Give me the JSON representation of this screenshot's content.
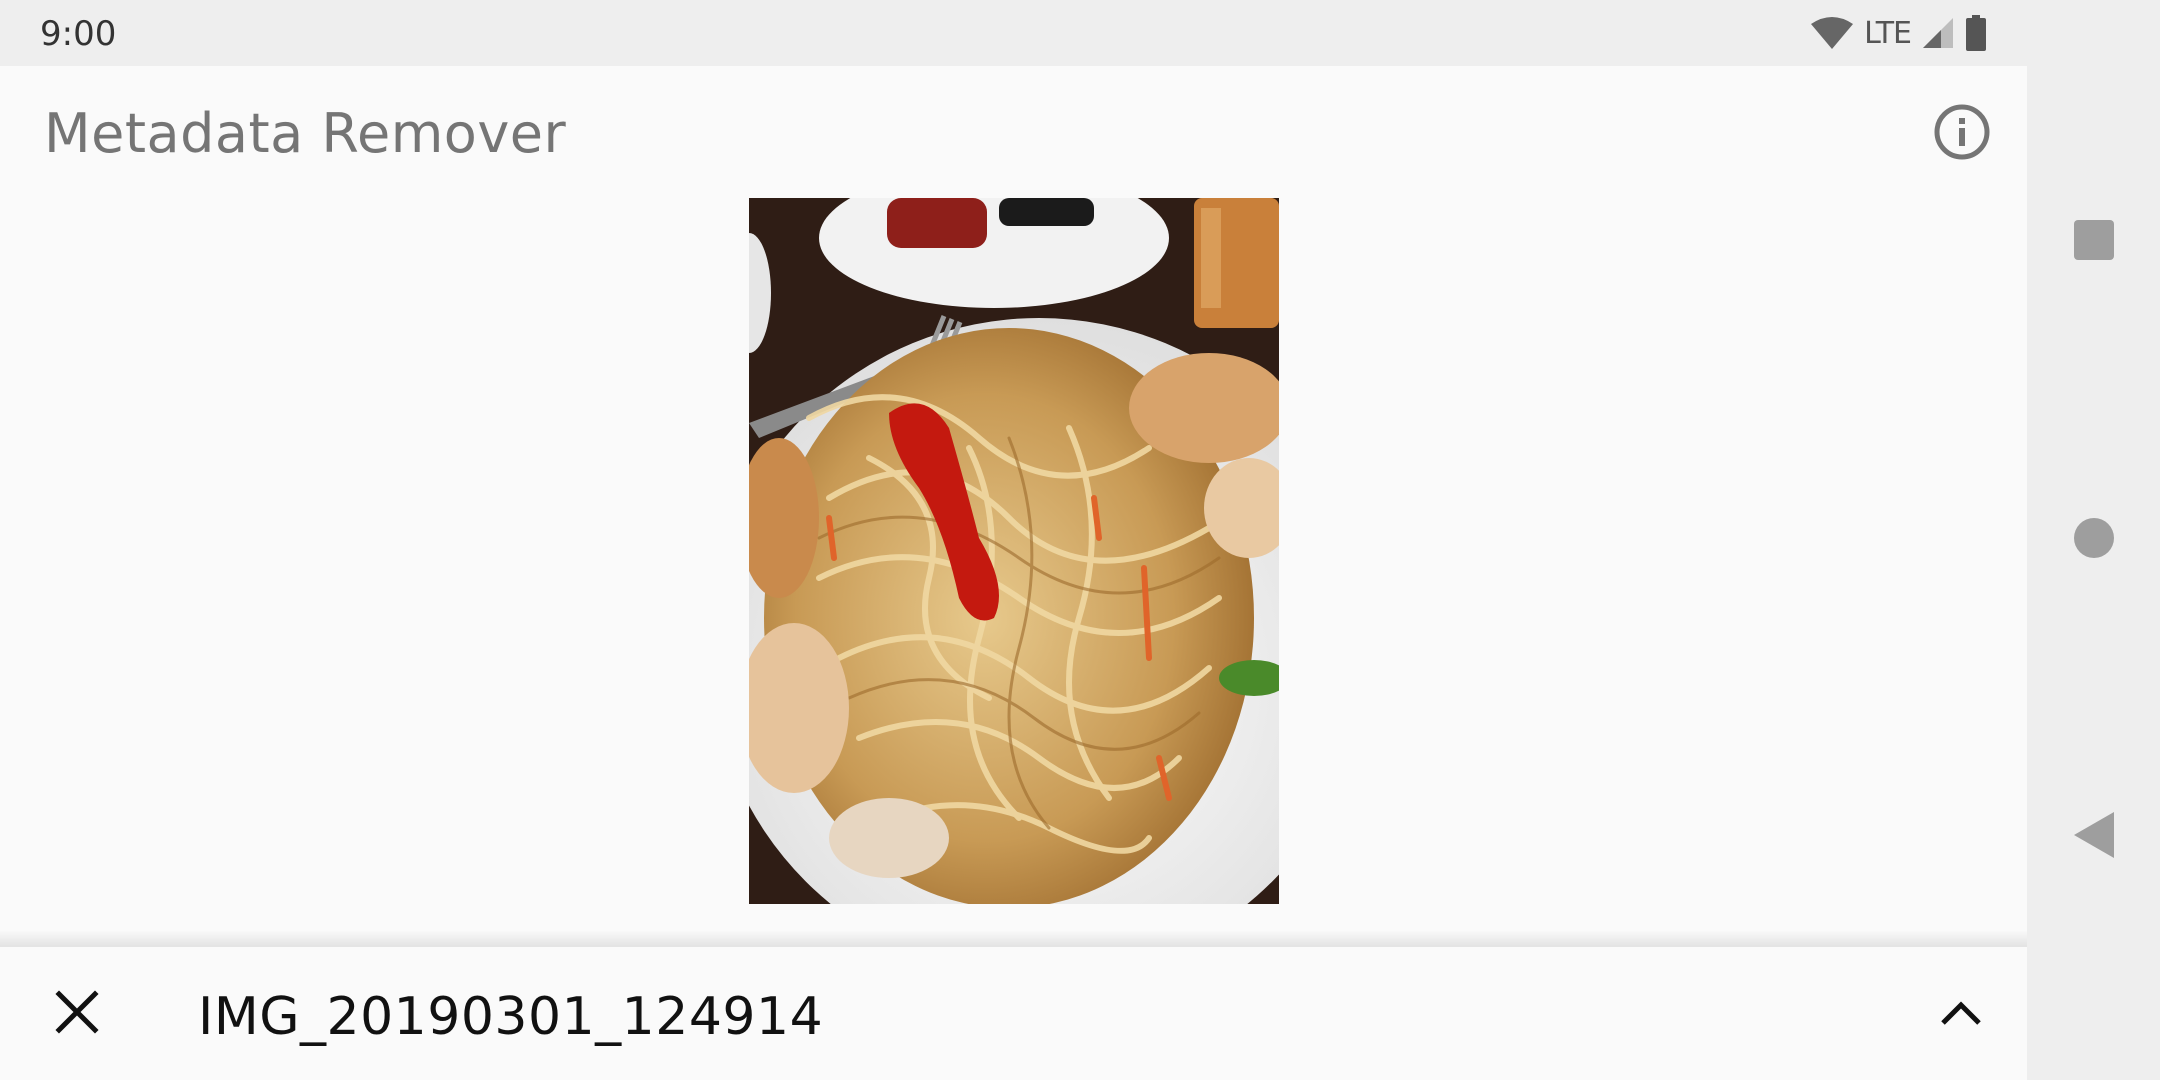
{
  "status_bar": {
    "time": "9:00",
    "network": "LTE",
    "icons": [
      "wifi-icon",
      "cell-signal-icon",
      "battery-icon"
    ]
  },
  "app_bar": {
    "title": "Metadata Remover",
    "info_icon": "info-icon"
  },
  "preview": {
    "image_subject": "plate of fried noodles with chili sauce"
  },
  "bottom_sheet": {
    "file_name": "IMG_20190301_124914",
    "close_icon": "close-icon",
    "expand_icon": "chevron-up-icon"
  },
  "nav_bar": {
    "icons": [
      "recents-icon",
      "home-icon",
      "back-icon"
    ]
  },
  "colors": {
    "status_bar_bg": "#eeeeee",
    "app_bg": "#fafafa",
    "title_text": "#757575",
    "file_name_text": "#111111"
  }
}
